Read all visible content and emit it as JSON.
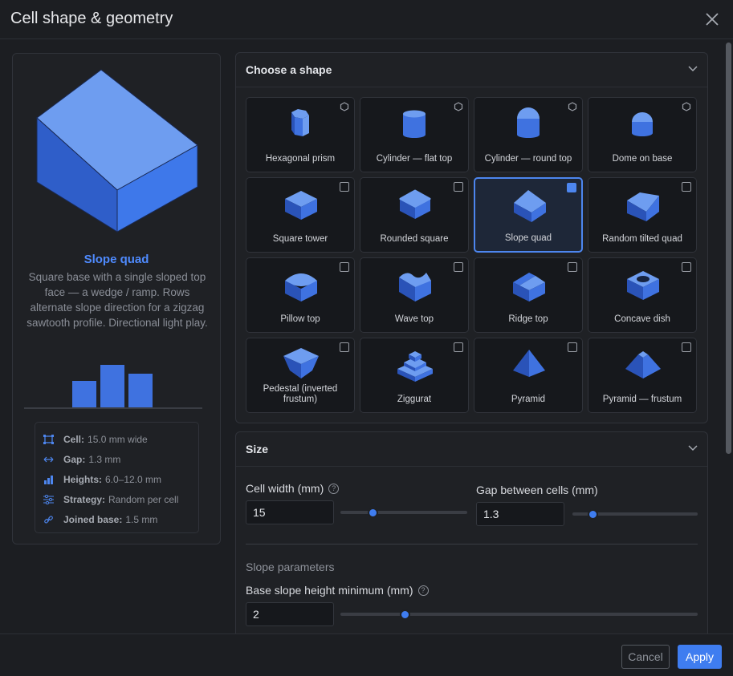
{
  "dialog": {
    "title": "Cell shape & geometry",
    "close_icon": "close-icon"
  },
  "preview": {
    "name": "Slope quad",
    "description": "Square base with a single sloped top face — a wedge / ramp. Rows alternate slope direction for a zigzag sawtooth profile. Directional light play.",
    "info": [
      {
        "icon": "cell-size-icon",
        "label": "Cell:",
        "value": "15.0 mm wide"
      },
      {
        "icon": "gap-arrows-icon",
        "label": "Gap:",
        "value": "1.3 mm"
      },
      {
        "icon": "bar-chart-icon",
        "label": "Heights:",
        "value": "6.0–12.0 mm"
      },
      {
        "icon": "sliders-icon",
        "label": "Strategy:",
        "value": "Random per cell"
      },
      {
        "icon": "link-icon",
        "label": "Joined base:",
        "value": "1.5 mm"
      }
    ]
  },
  "shapes": {
    "title": "Choose a shape",
    "items": [
      {
        "label": "Hexagonal prism",
        "mark": "hexagon",
        "selected": false
      },
      {
        "label": "Cylinder — flat top",
        "mark": "hexagon",
        "selected": false
      },
      {
        "label": "Cylinder — round top",
        "mark": "hexagon",
        "selected": false
      },
      {
        "label": "Dome on base",
        "mark": "hexagon",
        "selected": false
      },
      {
        "label": "Square tower",
        "mark": "checkbox",
        "selected": false
      },
      {
        "label": "Rounded square",
        "mark": "checkbox",
        "selected": false
      },
      {
        "label": "Slope quad",
        "mark": "checkbox",
        "selected": true
      },
      {
        "label": "Random tilted quad",
        "mark": "checkbox",
        "selected": false
      },
      {
        "label": "Pillow top",
        "mark": "checkbox",
        "selected": false
      },
      {
        "label": "Wave top",
        "mark": "checkbox",
        "selected": false
      },
      {
        "label": "Ridge top",
        "mark": "checkbox",
        "selected": false
      },
      {
        "label": "Concave dish",
        "mark": "checkbox",
        "selected": false
      },
      {
        "label": "Pedestal (inverted frustum)",
        "mark": "checkbox",
        "selected": false
      },
      {
        "label": "Ziggurat",
        "mark": "checkbox",
        "selected": false
      },
      {
        "label": "Pyramid",
        "mark": "checkbox",
        "selected": false
      },
      {
        "label": "Pyramid — frustum",
        "mark": "checkbox",
        "selected": false
      }
    ]
  },
  "size": {
    "title": "Size",
    "cell_width": {
      "label": "Cell width (mm)",
      "value": "15",
      "slider_fraction": 0.25
    },
    "gap": {
      "label": "Gap between cells (mm)",
      "value": "1.3",
      "slider_fraction": 0.16
    },
    "slope_heading": "Slope parameters",
    "slope_min": {
      "label": "Base slope height minimum (mm)",
      "value": "2",
      "slider_fraction": 0.18
    }
  },
  "footer": {
    "cancel": "Cancel",
    "apply": "Apply"
  },
  "colors": {
    "accent": "#3f7df0",
    "shape_light": "#6e9df0",
    "shape_mid": "#3f72e0",
    "shape_dark": "#2a53b8"
  }
}
